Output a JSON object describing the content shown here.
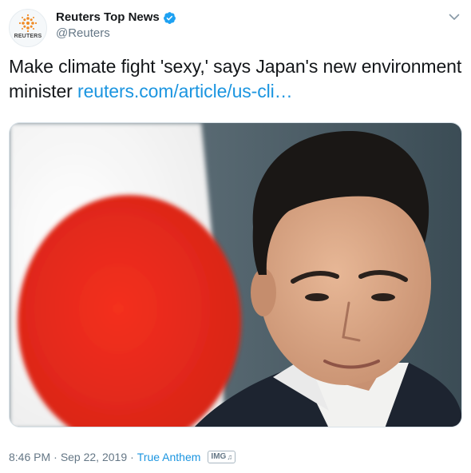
{
  "author": {
    "display_name": "Reuters Top News",
    "handle": "@Reuters",
    "avatar_brand": "REUTERS",
    "verified": true
  },
  "tweet": {
    "text": "Make climate fight 'sexy,' says Japan's new environment minister ",
    "link_text": "reuters.com/article/us-cli…"
  },
  "meta": {
    "time": "8:46 PM",
    "separator": "·",
    "date": "Sep 22, 2019",
    "source": "True Anthem",
    "media_badge": "IMG",
    "media_badge_glyph": "♫"
  },
  "colors": {
    "link": "#1b95e0",
    "verified": "#1da1f2",
    "secondary_text": "#657786",
    "flag_red": "#e32a1e",
    "brand_orange": "#f08a24"
  },
  "icons": {
    "caret": "chevron-down-icon",
    "verified": "verified-badge-icon"
  }
}
